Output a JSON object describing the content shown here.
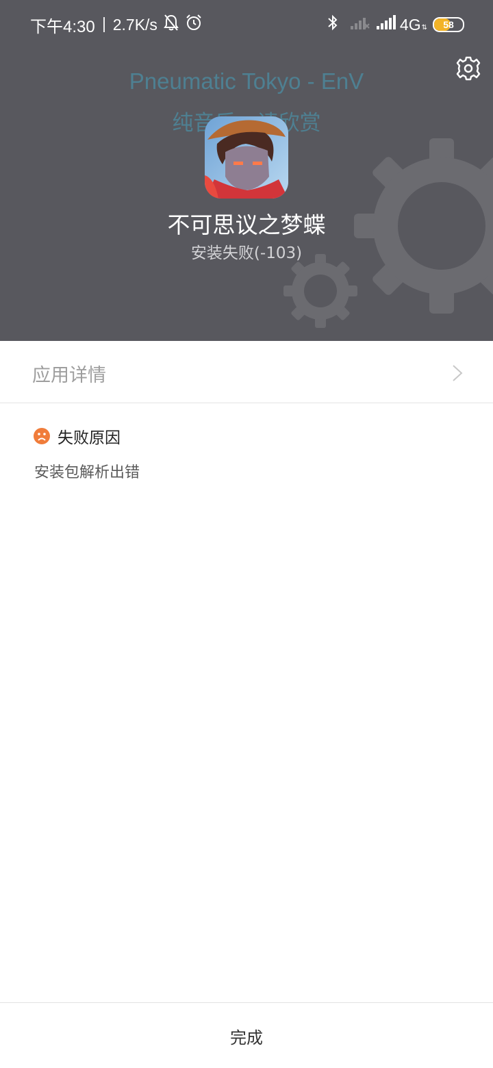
{
  "status_bar": {
    "time": "下午4:30",
    "net_speed": "2.7K/s",
    "network_type": "4G",
    "battery_level": "58",
    "icons": [
      "bell-off-icon",
      "alarm-icon",
      "bluetooth-icon",
      "signal-sim1-icon",
      "signal-sim2-icon",
      "battery-icon"
    ]
  },
  "header": {
    "music_title": "Pneumatic Tokyo - EnV",
    "music_subtitle": "纯音乐，请欣赏",
    "app_name": "不可思议之梦蝶",
    "install_status": "安装失败(-103)",
    "settings_icon": "gear-icon",
    "background_color": "#58585e",
    "lyric_color": "#4e8092"
  },
  "details": {
    "label": "应用详情"
  },
  "failure": {
    "title": "失败原因",
    "reason": "安装包解析出错",
    "icon": "sad-face-icon",
    "icon_color": "#f07c3a"
  },
  "footer": {
    "done_label": "完成"
  }
}
